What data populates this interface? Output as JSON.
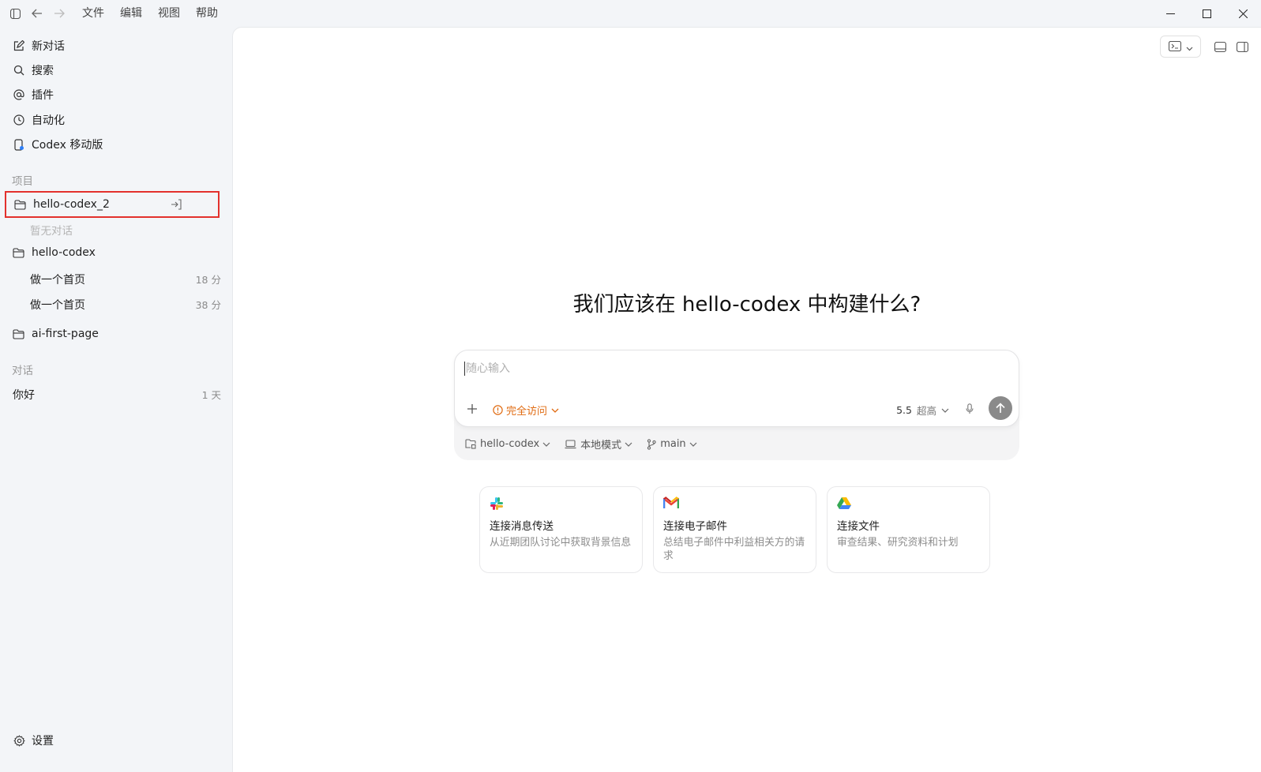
{
  "menu": [
    "文件",
    "编辑",
    "视图",
    "帮助"
  ],
  "sidebar": {
    "nav": [
      {
        "label": "新对话",
        "icon": "edit-icon"
      },
      {
        "label": "搜索",
        "icon": "search-icon"
      },
      {
        "label": "插件",
        "icon": "at-icon"
      },
      {
        "label": "自动化",
        "icon": "clock-icon"
      },
      {
        "label": "Codex 移动版",
        "icon": "phone-icon"
      }
    ],
    "projects_label": "项目",
    "projects": [
      {
        "name": "hello-codex_2",
        "empty": "暂无对话",
        "threads": []
      },
      {
        "name": "hello-codex",
        "threads": [
          {
            "title": "做一个首页",
            "age": "18 分"
          },
          {
            "title": "做一个首页",
            "age": "38 分"
          }
        ]
      },
      {
        "name": "ai-first-page",
        "threads": []
      }
    ],
    "chats_label": "对话",
    "chats": [
      {
        "title": "你好",
        "age": "1 天"
      }
    ],
    "settings_label": "设置"
  },
  "main": {
    "heading": "我们应该在 hello-codex 中构建什么?",
    "composer": {
      "placeholder": "随心输入",
      "access_label": "完全访问",
      "model": "5.5",
      "level": "超高"
    },
    "meta": {
      "project": "hello-codex",
      "mode": "本地模式",
      "branch": "main"
    },
    "cards": [
      {
        "title": "连接消息传送",
        "desc": "从近期团队讨论中获取背景信息",
        "icon": "slack-icon"
      },
      {
        "title": "连接电子邮件",
        "desc": "总结电子邮件中利益相关方的请求",
        "icon": "gmail-icon"
      },
      {
        "title": "连接文件",
        "desc": "审查结果、研究资料和计划",
        "icon": "drive-icon"
      }
    ]
  },
  "colors": {
    "accent": "#e06b12",
    "highlight": "#e3312d",
    "send": "#8a8a8a"
  }
}
